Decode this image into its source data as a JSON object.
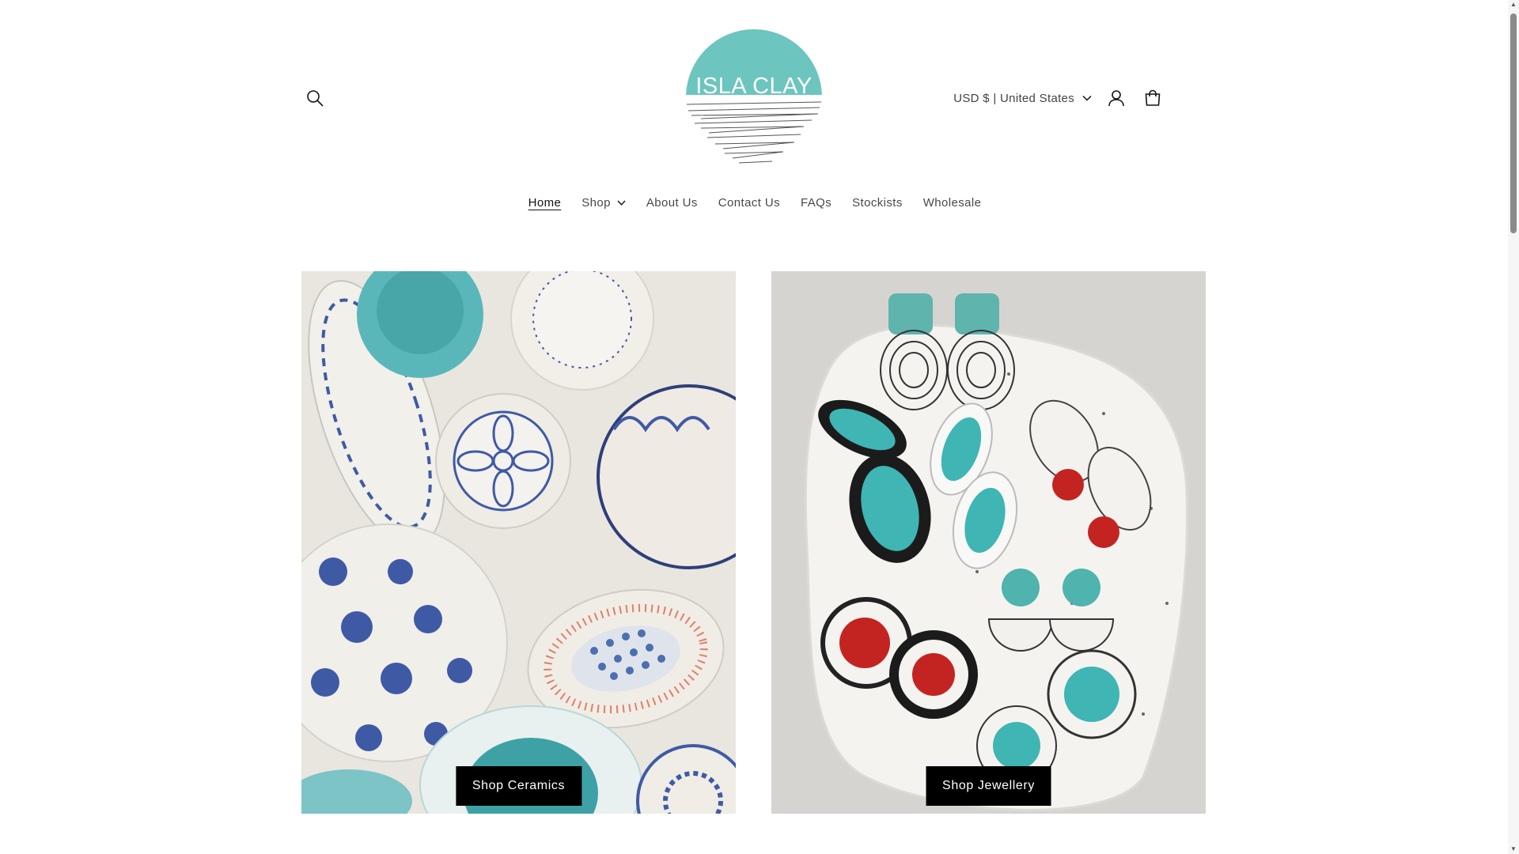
{
  "header": {
    "logo_text": "ISLA CLAY",
    "currency_label": "USD $ | United States",
    "search_icon": "search-icon",
    "account_icon": "account-icon",
    "cart_icon": "cart-icon"
  },
  "nav": {
    "items": [
      {
        "label": "Home",
        "active": true
      },
      {
        "label": "Shop",
        "has_dropdown": true
      },
      {
        "label": "About Us"
      },
      {
        "label": "Contact Us"
      },
      {
        "label": "FAQs"
      },
      {
        "label": "Stockists"
      },
      {
        "label": "Wholesale"
      }
    ]
  },
  "collections": [
    {
      "button_label": "Shop Ceramics"
    },
    {
      "button_label": "Shop Jewellery"
    }
  ],
  "colors": {
    "brand_teal": "#6cc5bf",
    "button_bg": "#000000",
    "button_text": "#ffffff",
    "text": "#121212"
  }
}
